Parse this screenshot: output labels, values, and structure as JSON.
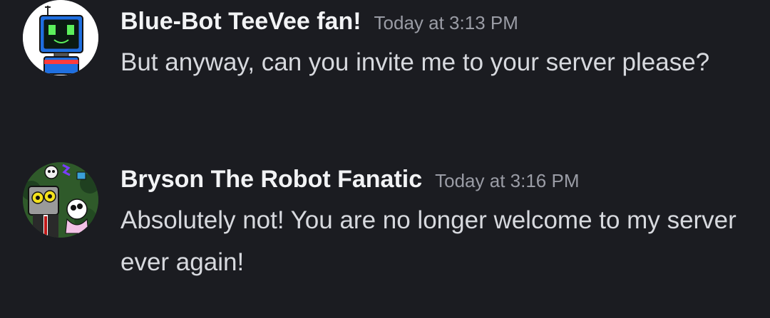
{
  "messages": [
    {
      "username": "Blue-Bot TeeVee fan!",
      "timestamp": "Today at 3:13 PM",
      "text": "But anyway, can you invite me to your server please?",
      "avatar_icon": "blue-robot-tv-avatar"
    },
    {
      "username": "Bryson The Robot Fanatic",
      "timestamp": "Today at 3:16 PM",
      "text": "Absolutely not! You are no longer welcome to my server ever again!",
      "avatar_icon": "robot-characters-avatar"
    }
  ],
  "colors": {
    "background": "#1b1c21",
    "username": "#f2f3f5",
    "timestamp": "#9a9ca5",
    "message_text": "#d7d9de"
  }
}
